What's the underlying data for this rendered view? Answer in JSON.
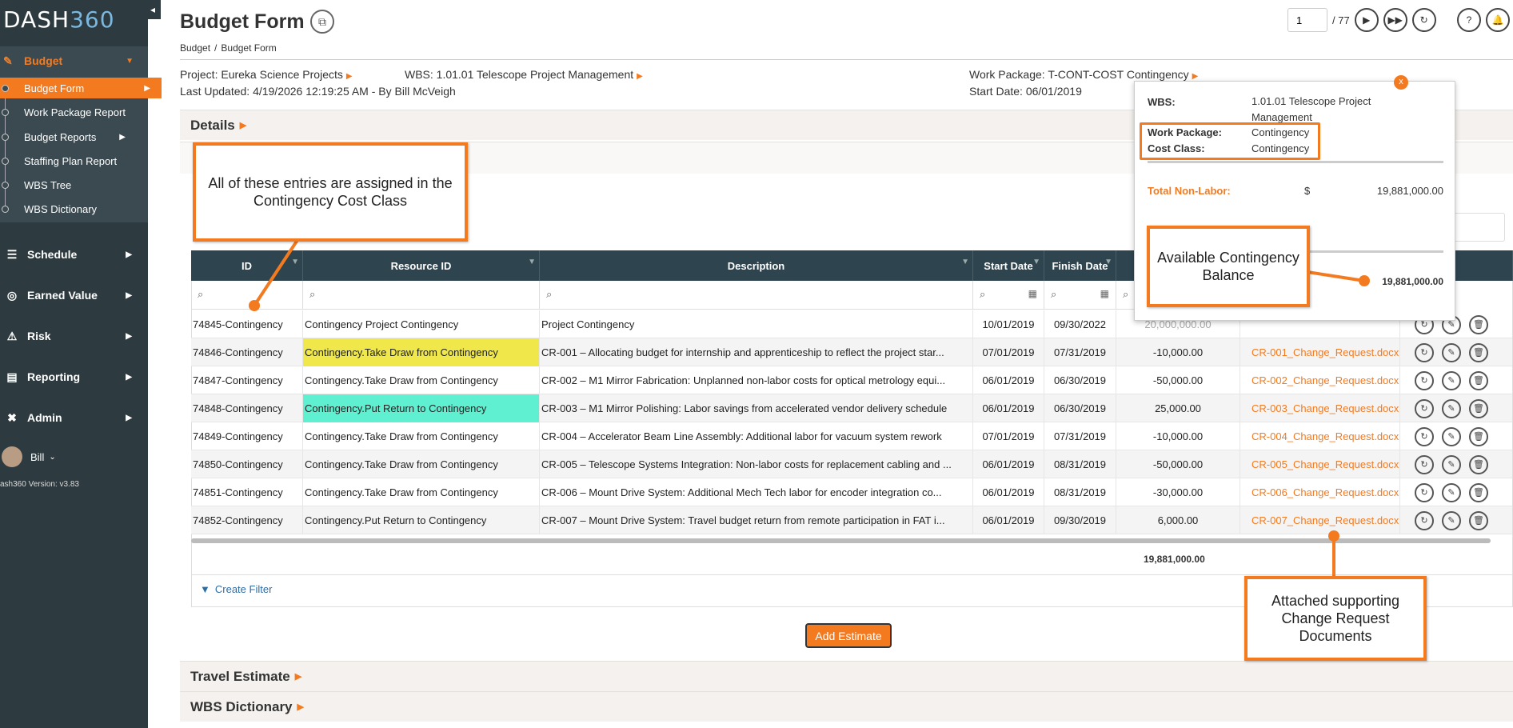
{
  "sidebar": {
    "logo_prefix": "DASH",
    "logo_num": "360",
    "collapse_icon": "◂",
    "budget_label": "Budget",
    "sub_items": [
      {
        "label": "Budget Form"
      },
      {
        "label": "Work Package Report"
      },
      {
        "label": "Budget Reports"
      },
      {
        "label": "Staffing Plan Report"
      },
      {
        "label": "WBS Tree"
      },
      {
        "label": "WBS Dictionary"
      }
    ],
    "nav_items": [
      {
        "label": "Schedule",
        "icon": "schedule-icon"
      },
      {
        "label": "Earned Value",
        "icon": "earned-value-icon"
      },
      {
        "label": "Risk",
        "icon": "risk-icon"
      },
      {
        "label": "Reporting",
        "icon": "reporting-icon"
      },
      {
        "label": "Admin",
        "icon": "admin-icon"
      }
    ],
    "user_name": "Bill",
    "version": "ash360 Version: v3.83"
  },
  "header": {
    "title": "Budget Form",
    "breadcrumb": [
      "Budget",
      "Budget Form"
    ],
    "page_current": "1",
    "page_total": "/ 77"
  },
  "info": {
    "project_label": "Project:",
    "project_value": "Eureka Science Projects",
    "wbs_label": "WBS:",
    "wbs_value": "1.01.01 Telescope Project Management",
    "work_package_label": "Work Package:",
    "work_package_value": "T-CONT-COST Contingency",
    "last_updated_label": "Last Updated:",
    "last_updated_value": "4/19/2026 12:19:25 AM - By Bill McVeigh",
    "start_date_label": "Start Date:",
    "start_date_value": "06/01/2019"
  },
  "sections": {
    "details": "Details",
    "travel": "Travel Estimate",
    "wbs_dictionary": "WBS Dictionary"
  },
  "table": {
    "headers": {
      "id": "ID",
      "resource_id": "Resource ID",
      "description": "Description",
      "start_date": "Start Date",
      "finish_date": "Finish Date"
    },
    "rows": [
      {
        "id": "74845-Contingency",
        "resource": "Contingency Project Contingency",
        "description": "Project Contingency",
        "start": "10/01/2019",
        "finish": "09/30/2022",
        "amount": "20,000,000.00",
        "doc": ""
      },
      {
        "id": "74846-Contingency",
        "resource": "Contingency.Take Draw from Contingency",
        "description": "CR-001 – Allocating budget for internship and apprenticeship to reflect the project star...",
        "start": "07/01/2019",
        "finish": "07/31/2019",
        "amount": "-10,000.00",
        "doc": "CR-001_Change_Request.docx"
      },
      {
        "id": "74847-Contingency",
        "resource": "Contingency.Take Draw from Contingency",
        "description": "CR-002 – M1 Mirror Fabrication: Unplanned non-labor costs for optical metrology equi...",
        "start": "06/01/2019",
        "finish": "06/30/2019",
        "amount": "-50,000.00",
        "doc": "CR-002_Change_Request.docx"
      },
      {
        "id": "74848-Contingency",
        "resource": "Contingency.Put Return to Contingency",
        "description": "CR-003 – M1 Mirror Polishing: Labor savings from accelerated vendor delivery schedule",
        "start": "06/01/2019",
        "finish": "06/30/2019",
        "amount": "25,000.00",
        "doc": "CR-003_Change_Request.docx"
      },
      {
        "id": "74849-Contingency",
        "resource": "Contingency.Take Draw from Contingency",
        "description": "CR-004 – Accelerator Beam Line Assembly: Additional labor for vacuum system rework",
        "start": "07/01/2019",
        "finish": "07/31/2019",
        "amount": "-10,000.00",
        "doc": "CR-004_Change_Request.docx"
      },
      {
        "id": "74850-Contingency",
        "resource": "Contingency.Take Draw from Contingency",
        "description": "CR-005 – Telescope Systems Integration: Non-labor costs for replacement cabling and ...",
        "start": "06/01/2019",
        "finish": "08/31/2019",
        "amount": "-50,000.00",
        "doc": "CR-005_Change_Request.docx"
      },
      {
        "id": "74851-Contingency",
        "resource": "Contingency.Take Draw from Contingency",
        "description": "CR-006 – Mount Drive System: Additional Mech Tech labor for encoder integration co...",
        "start": "06/01/2019",
        "finish": "08/31/2019",
        "amount": "-30,000.00",
        "doc": "CR-006_Change_Request.docx"
      },
      {
        "id": "74852-Contingency",
        "resource": "Contingency.Put Return to Contingency",
        "description": "CR-007 – Mount Drive System: Travel budget return from remote participation in FAT i...",
        "start": "06/01/2019",
        "finish": "09/30/2019",
        "amount": "6,000.00",
        "doc": "CR-007_Change_Request.docx"
      }
    ],
    "total": "19,881,000.00",
    "create_filter": "Create Filter"
  },
  "add_estimate": "Add Estimate",
  "popup": {
    "close": "x",
    "wbs_label": "WBS:",
    "wbs_value": "1.01.01 Telescope Project Management",
    "wp_label": "Work Package:",
    "wp_value": "Contingency",
    "cc_label": "Cost Class:",
    "cc_value": "Contingency",
    "tnl_label": "Total Non-Labor:",
    "currency": "$",
    "tnl_value": "19,881,000.00",
    "balance_value": "19,881,000.00"
  },
  "callouts": {
    "cost_class": "All of these entries are assigned in the Contingency Cost Class",
    "balance": "Available Contingency Balance",
    "documents": "Attached supporting Change Request Documents"
  },
  "colors": {
    "accent": "#f47a20",
    "sidebar": "#2d3a3f",
    "table_header": "#2e4550",
    "yellow_highlight": "#f0e84a",
    "teal_highlight": "#5ef0d0"
  }
}
